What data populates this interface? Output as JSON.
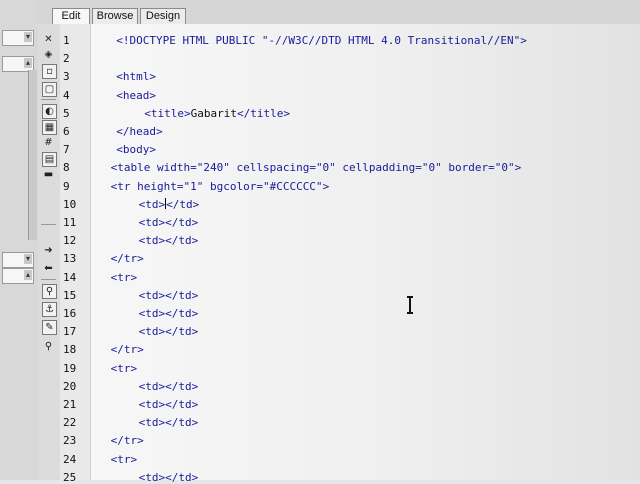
{
  "tabs": [
    {
      "label": "Edit",
      "active": true
    },
    {
      "label": "Browse",
      "active": false
    },
    {
      "label": "Design",
      "active": false
    }
  ],
  "toolbar_icons": [
    "close-icon",
    "expand-icon",
    "dialog-icon",
    "window-icon",
    "image-icon",
    "table-icon",
    "column-icon",
    "hash-icon",
    "file-icon",
    "layout-icon",
    "arrow-right-icon",
    "arrow-left-icon",
    "link-icon",
    "anchor-icon",
    "script-icon",
    "search-icon"
  ],
  "gutter": {
    "line_numbers": [
      "1",
      "2",
      "3",
      "4",
      "5",
      "6",
      "7",
      "8",
      "9",
      "10",
      "11",
      "12",
      "13",
      "14",
      "15",
      "16",
      "17",
      "18",
      "19",
      "20",
      "21",
      "22",
      "23",
      "24",
      "25"
    ]
  },
  "code_lines": [
    {
      "indent": 2,
      "segments": [
        {
          "t": "doc",
          "v": "<!DOCTYPE HTML PUBLIC \"-//W3C//DTD HTML 4.0 Transitional//EN\">"
        }
      ]
    },
    {
      "indent": 2,
      "segments": []
    },
    {
      "indent": 2,
      "segments": [
        {
          "t": "tag",
          "v": "<html>"
        }
      ]
    },
    {
      "indent": 2,
      "segments": [
        {
          "t": "tag",
          "v": "<head>"
        }
      ]
    },
    {
      "indent": 7,
      "segments": [
        {
          "t": "tag",
          "v": "<title>"
        },
        {
          "t": "text",
          "v": "Gabarit"
        },
        {
          "t": "tag",
          "v": "</title>"
        }
      ]
    },
    {
      "indent": 2,
      "segments": [
        {
          "t": "tag",
          "v": "</head>"
        }
      ]
    },
    {
      "indent": 2,
      "segments": [
        {
          "t": "tag",
          "v": "<body>"
        }
      ]
    },
    {
      "indent": 1,
      "segments": [
        {
          "t": "tag",
          "v": "<table "
        },
        {
          "t": "attr",
          "v": "width="
        },
        {
          "t": "val",
          "v": "\"240\""
        },
        {
          "t": "attr",
          "v": " cellspacing="
        },
        {
          "t": "val",
          "v": "\"0\""
        },
        {
          "t": "attr",
          "v": " cellpadding="
        },
        {
          "t": "val",
          "v": "\"0\""
        },
        {
          "t": "attr",
          "v": " border="
        },
        {
          "t": "val",
          "v": "\"0\""
        },
        {
          "t": "tag",
          "v": ">"
        }
      ]
    },
    {
      "indent": 1,
      "segments": [
        {
          "t": "tag",
          "v": "<tr "
        },
        {
          "t": "attr",
          "v": "height="
        },
        {
          "t": "val",
          "v": "\"1\""
        },
        {
          "t": "attr",
          "v": " bgcolor="
        },
        {
          "t": "val",
          "v": "\"#CCCCCC\""
        },
        {
          "t": "tag",
          "v": ">"
        }
      ]
    },
    {
      "indent": 6,
      "segments": [
        {
          "t": "tag",
          "v": "<td>"
        },
        {
          "t": "caret",
          "v": ""
        },
        {
          "t": "tag",
          "v": "</td>"
        }
      ]
    },
    {
      "indent": 6,
      "segments": [
        {
          "t": "tag",
          "v": "<td></td>"
        }
      ]
    },
    {
      "indent": 6,
      "segments": [
        {
          "t": "tag",
          "v": "<td></td>"
        }
      ]
    },
    {
      "indent": 1,
      "segments": [
        {
          "t": "tag",
          "v": "</tr>"
        }
      ]
    },
    {
      "indent": 1,
      "segments": [
        {
          "t": "tag",
          "v": "<tr>"
        }
      ]
    },
    {
      "indent": 6,
      "segments": [
        {
          "t": "tag",
          "v": "<td></td>"
        }
      ]
    },
    {
      "indent": 6,
      "segments": [
        {
          "t": "tag",
          "v": "<td></td>"
        }
      ]
    },
    {
      "indent": 6,
      "segments": [
        {
          "t": "tag",
          "v": "<td></td>"
        }
      ]
    },
    {
      "indent": 1,
      "segments": [
        {
          "t": "tag",
          "v": "</tr>"
        }
      ]
    },
    {
      "indent": 1,
      "segments": [
        {
          "t": "tag",
          "v": "<tr>"
        }
      ]
    },
    {
      "indent": 6,
      "segments": [
        {
          "t": "tag",
          "v": "<td></td>"
        }
      ]
    },
    {
      "indent": 6,
      "segments": [
        {
          "t": "tag",
          "v": "<td></td>"
        }
      ]
    },
    {
      "indent": 6,
      "segments": [
        {
          "t": "tag",
          "v": "<td></td>"
        }
      ]
    },
    {
      "indent": 1,
      "segments": [
        {
          "t": "tag",
          "v": "</tr>"
        }
      ]
    },
    {
      "indent": 1,
      "segments": [
        {
          "t": "tag",
          "v": "<tr>"
        }
      ]
    },
    {
      "indent": 6,
      "segments": [
        {
          "t": "tag",
          "v": "<td></td>"
        }
      ]
    }
  ],
  "colors": {
    "code_blue": "#1a1a9a",
    "text_dark": "#111111",
    "editor_bg": "#f2f2f2"
  }
}
